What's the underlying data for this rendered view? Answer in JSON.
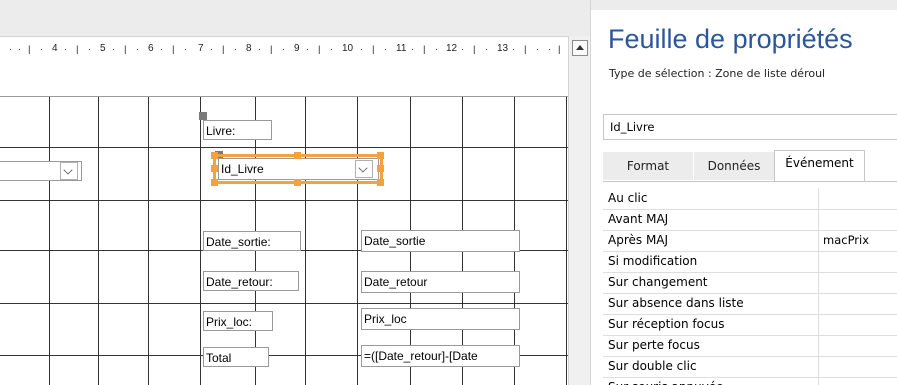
{
  "ruler": {
    "numbers": [
      "4",
      "5",
      "6",
      "7",
      "8",
      "9",
      "10",
      "11",
      "12",
      "13"
    ]
  },
  "form": {
    "labels": {
      "livre": "Livre:",
      "date_sortie": "Date_sortie:",
      "date_retour": "Date_retour:",
      "prix_loc": "Prix_loc:",
      "total": "Total"
    },
    "fields": {
      "id_livre": "Id_Livre",
      "date_sortie": "Date_sortie",
      "date_retour": "Date_retour",
      "prix_loc": "Prix_loc",
      "total": "=([Date_retour]-[Date"
    }
  },
  "properties": {
    "title": "Feuille de propriétés",
    "selection_type": "Type de sélection :  Zone de liste déroul",
    "object": "Id_Livre",
    "tabs": [
      "Format",
      "Données",
      "Événement"
    ],
    "active_tab": "Événement",
    "rows": [
      {
        "name": "Au clic",
        "value": ""
      },
      {
        "name": "Avant MAJ",
        "value": ""
      },
      {
        "name": "Après MAJ",
        "value": "macPrix"
      },
      {
        "name": "Si modification",
        "value": ""
      },
      {
        "name": "Sur changement",
        "value": ""
      },
      {
        "name": "Sur absence dans liste",
        "value": ""
      },
      {
        "name": "Sur réception focus",
        "value": ""
      },
      {
        "name": "Sur perte focus",
        "value": ""
      },
      {
        "name": "Sur double clic",
        "value": ""
      },
      {
        "name": "Sur souris appuyée",
        "value": ""
      }
    ]
  },
  "colors": {
    "title_blue": "#2b579a",
    "selection_orange": "#f5a142"
  },
  "icons": {
    "scroll_up": "triangle-up-icon",
    "dropdown": "chevron-down-icon"
  }
}
